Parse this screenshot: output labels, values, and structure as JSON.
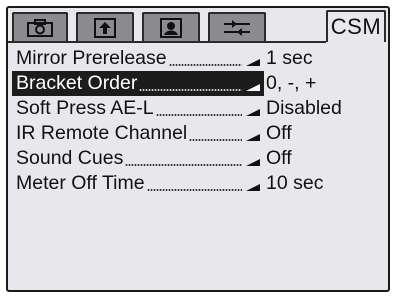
{
  "tabs": [
    {
      "icon": "camera-icon"
    },
    {
      "icon": "shooting-menu-icon"
    },
    {
      "icon": "playback-menu-icon"
    },
    {
      "icon": "setup-menu-icon"
    },
    {
      "label": "CSM"
    }
  ],
  "menu": {
    "items": [
      {
        "name": "Mirror Prerelease",
        "value": "1 sec",
        "selected": false
      },
      {
        "name": "Bracket Order",
        "value": "0, -, +",
        "selected": true
      },
      {
        "name": "Soft Press AE-L",
        "value": "Disabled",
        "selected": false
      },
      {
        "name": "IR Remote Channel",
        "value": "Off",
        "selected": false
      },
      {
        "name": "Sound Cues",
        "value": "Off",
        "selected": false
      },
      {
        "name": "Meter Off Time",
        "value": "10 sec",
        "selected": false
      }
    ]
  },
  "colors": {
    "background": "#e8e8ec",
    "tab_inactive": "#8c8c90",
    "highlight": "#1c1c1c",
    "text": "#111111"
  }
}
